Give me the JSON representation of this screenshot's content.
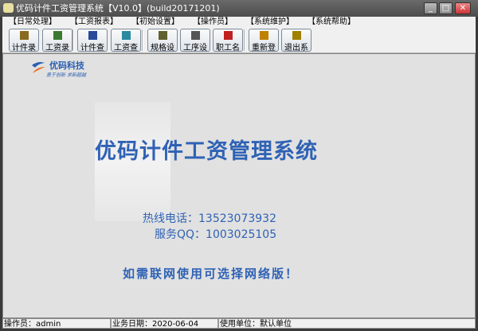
{
  "window": {
    "title": "优码计件工资管理系统【V10.0】(build20171201)",
    "minimize": "_",
    "maximize": "□",
    "close": "✕"
  },
  "menu": [
    "【日常处理】",
    "【工资报表】",
    "【初始设置】",
    "【操作员】",
    "【系统维护】",
    "【系统帮助】"
  ],
  "toolbar": [
    {
      "label": "计件录入",
      "icon": "piece-entry-icon",
      "color": "#8a6a20"
    },
    {
      "label": "工资录入",
      "icon": "wage-entry-icon",
      "color": "#3a7a30"
    },
    {
      "label": "计件查询",
      "icon": "piece-query-icon",
      "color": "#2a4a9a"
    },
    {
      "label": "工资查询",
      "icon": "wage-query-icon",
      "color": "#2a8aa0"
    },
    {
      "label": "规格设置",
      "icon": "spec-settings-icon",
      "color": "#606030"
    },
    {
      "label": "工序设置",
      "icon": "process-settings-icon",
      "color": "#555555"
    },
    {
      "label": "职工名册",
      "icon": "employee-roster-icon",
      "color": "#c02020"
    },
    {
      "label": "重新登陆",
      "icon": "relogin-icon",
      "color": "#c08000"
    },
    {
      "label": "退出系统",
      "icon": "exit-icon",
      "color": "#a08000"
    }
  ],
  "logo": {
    "name": "优码科技",
    "slogan": "勇于创新 求新超越"
  },
  "main": {
    "title": "优码计件工资管理系统",
    "hotline": "热线电话：13523073932",
    "qq": "服务QQ：1003025105",
    "promo": "如需联网使用可选择网络版！"
  },
  "status": {
    "operator": "操作员：admin",
    "date": "业务日期：2020-06-04",
    "unit": "使用单位：默认单位"
  }
}
